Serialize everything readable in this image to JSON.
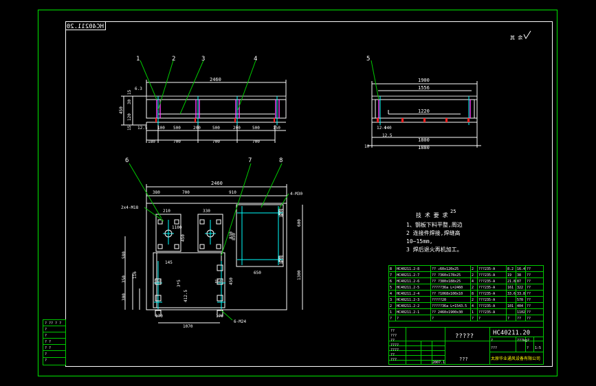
{
  "drawing": {
    "number": "HC40211.20",
    "number_mirrored": "HC40211.20",
    "roughness": "其 余",
    "title_unknown": "?????",
    "scale_text": "???",
    "company": "太原华业通风设备有限公司",
    "title_right_cells": [
      "?",
      "???",
      "?",
      "1:5"
    ],
    "weight_cell": "???kg?"
  },
  "callouts": [
    "1",
    "2",
    "3",
    "4",
    "5",
    "6",
    "7",
    "8"
  ],
  "front_view": {
    "overall": "2460",
    "left_dims": [
      "15",
      "30",
      "15",
      "120",
      "15",
      "450"
    ],
    "angle": "6.3",
    "flange": "12.5",
    "segments": [
      "100",
      "500",
      "200",
      "500",
      "200",
      "500",
      "150"
    ],
    "bottom": [
      "180",
      "700",
      "700",
      "700"
    ]
  },
  "side_view": {
    "top": "1900",
    "inner": "1556",
    "center": "1220",
    "bottom": "1800",
    "bottom_outer": "1880",
    "hole": "12-Φ40",
    "flange": "12.5",
    "left": "10"
  },
  "plan_view": {
    "overall": "2460",
    "top_dims": [
      "380",
      "700",
      "910"
    ],
    "holes_a": "2x4-M18",
    "holes_b": "4-M30",
    "holes_c": "6-M24",
    "dims": [
      "210",
      "330",
      "1100",
      "600",
      "850",
      "650",
      "580",
      "350",
      "300",
      "145",
      "160",
      "160",
      "170",
      "170",
      "1070",
      "120",
      "120",
      "450",
      "450",
      "116",
      "830",
      "1300",
      "3*5",
      "412.5"
    ]
  },
  "tech_notes": {
    "heading": "技 术 要 求",
    "lines": [
      "1、钢板下料平整,周边",
      "2  连接件焊接,焊缝高",
      "10~15mm,",
      "3  焊后退火再机加工。"
    ],
    "mark": "25"
  },
  "bom": [
    [
      "8",
      "HC40211.2-8",
      "?? ∠60x120x25",
      "2",
      "???235-A",
      "8.2",
      "16.4",
      "??"
    ],
    [
      "7",
      "HC40211.2-7",
      "?? ?360x178x25",
      "2",
      "???235-A",
      "19",
      "38",
      "??"
    ],
    [
      "6",
      "HC40211.2-6",
      "?? ?380x188x25",
      "4",
      "???235-A",
      "21.8",
      "87",
      "??"
    ],
    [
      "5",
      "HC40211.2-5",
      "?????36a L=2460",
      "2",
      "???235-A",
      "161",
      "322",
      "??"
    ],
    [
      "4",
      "HC40211.2-4",
      "?? ?1068x100x10",
      "8",
      "???235-A",
      "33.6",
      "33.8",
      "??"
    ],
    [
      "3",
      "HC40211.2-3",
      "?????20",
      "2",
      "???235-A",
      "",
      "570",
      "??"
    ],
    [
      "2",
      "HC40211.2-2",
      "?????36a L=1543.5",
      "4",
      "???235-A",
      "101",
      "404",
      "??"
    ],
    [
      "1",
      "HC40211.2-1",
      "?? 2460x1900x30",
      "1",
      "???235-A",
      "",
      "1102",
      "??"
    ],
    [
      "?",
      "?",
      "?",
      "?",
      "?",
      "?",
      "??",
      "??"
    ]
  ],
  "left_strip": [
    "? ?? ? ?",
    "?",
    "?",
    "? ?",
    "? ?",
    "?",
    "?"
  ],
  "signature_rows": [
    "??",
    "???",
    "??",
    "????",
    "????",
    "??",
    "???"
  ],
  "date": "2007.1"
}
